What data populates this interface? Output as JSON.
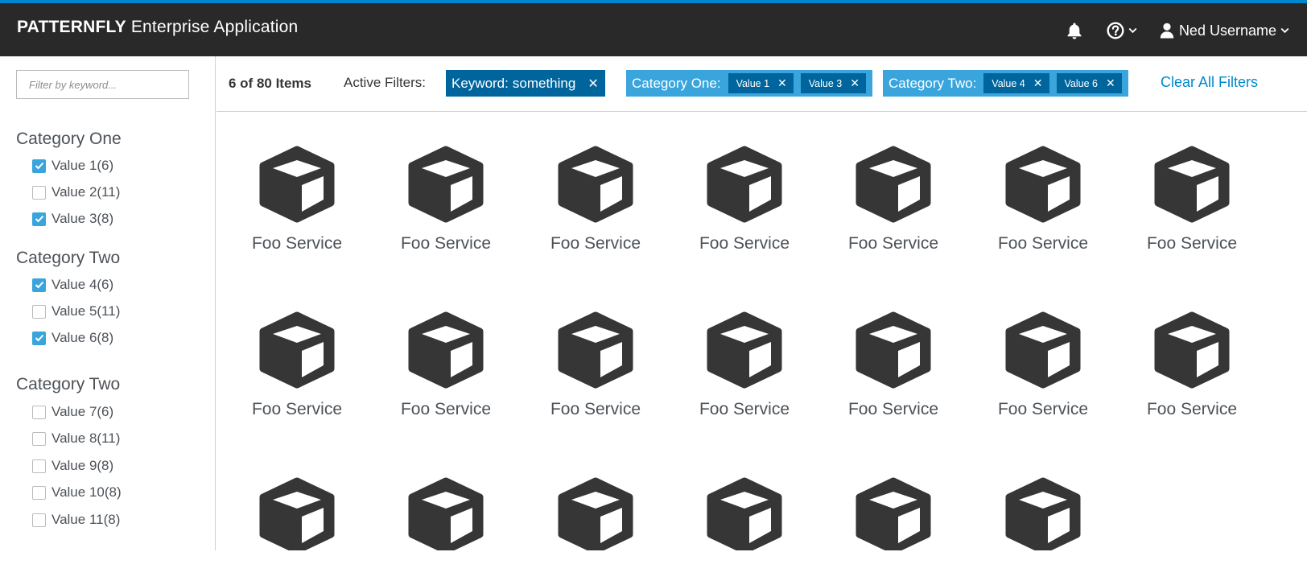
{
  "masthead": {
    "brand_strong": "PATTERNFLY",
    "brand_rest": " Enterprise Application",
    "user_name": "Ned Username",
    "icons": [
      "bell-icon",
      "help-icon",
      "chevron-down-icon",
      "user-icon"
    ]
  },
  "sidebar": {
    "search_placeholder": "Filter by keyword...",
    "categories": [
      {
        "title": "Category One",
        "options": [
          {
            "label": "Value 1(6)",
            "checked": true
          },
          {
            "label": "Value 2(11)",
            "checked": false
          },
          {
            "label": "Value 3(8)",
            "checked": true
          }
        ]
      },
      {
        "title": "Category Two",
        "options": [
          {
            "label": "Value 4(6)",
            "checked": true
          },
          {
            "label": "Value 5(11)",
            "checked": false
          },
          {
            "label": "Value 6(8)",
            "checked": true
          }
        ]
      },
      {
        "title": "Category Two",
        "options": [
          {
            "label": "Value 7(6)",
            "checked": false
          },
          {
            "label": "Value 8(11)",
            "checked": false
          },
          {
            "label": "Value 9(8)",
            "checked": false
          },
          {
            "label": "Value 10(8)",
            "checked": false
          },
          {
            "label": "Value 11(8)",
            "checked": false
          }
        ]
      }
    ]
  },
  "toolbar": {
    "items_count": "6 of 80 Items",
    "active_filters_label": "Active Filters:",
    "keyword_chip": {
      "category": "Keyword:",
      "value": "something"
    },
    "category_one_chip": {
      "category": "Category One:",
      "values": [
        "Value 1",
        "Value 3"
      ]
    },
    "category_two_chip": {
      "category": "Category Two:",
      "values": [
        "Value 4",
        "Value 6"
      ]
    },
    "clear_all": "Clear All Filters",
    "close_glyph": "✕"
  },
  "items": [
    "Foo Service",
    "Foo Service",
    "Foo Service",
    "Foo Service",
    "Foo Service",
    "Foo Service",
    "Foo Service",
    "Foo Service",
    "Foo Service",
    "Foo Service",
    "Foo Service",
    "Foo Service",
    "Foo Service",
    "Foo Service",
    "",
    "",
    "",
    "",
    "",
    ""
  ],
  "colors": {
    "masthead_bg": "#292929",
    "accent_blue": "#0088ce",
    "chip_dark": "#00659c",
    "chip_light": "#39a5dc",
    "icon_dark": "#363636"
  }
}
